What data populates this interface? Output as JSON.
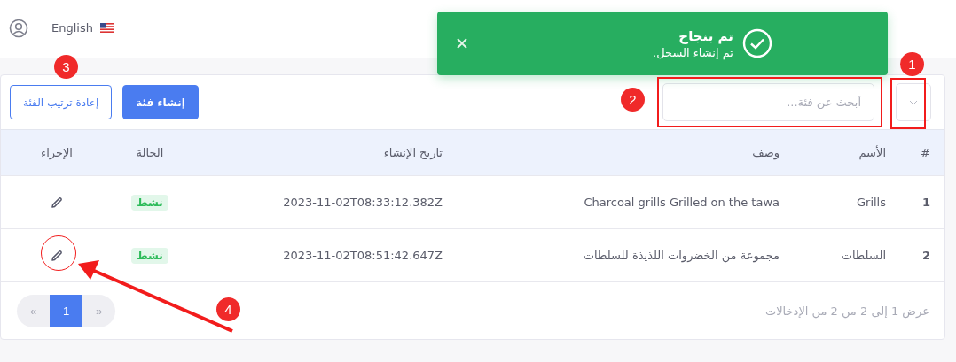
{
  "top_bar": {
    "language": "English"
  },
  "toast": {
    "title": "تم بنجاح",
    "message": "تم إنشاء السجل."
  },
  "toolbar": {
    "search": {
      "placeholder": "أبحث عن فئة..."
    },
    "buttons": [
      {
        "label": "إنشاء فئة",
        "kind": "primary"
      },
      {
        "label": "إعادة ترتيب الفئة",
        "kind": "outline"
      }
    ]
  },
  "table": {
    "columns": [
      "#",
      "الأسم",
      "وصف",
      "تاريخ الإنشاء",
      "الحالة",
      "الإجراء"
    ],
    "rows": [
      {
        "index": "1",
        "name": "Grills",
        "description": "Charcoal grills Grilled on the tawa",
        "created": "2023-11-02T08:33:12.382Z",
        "status": {
          "label": "نشط",
          "kind": "active"
        }
      },
      {
        "index": "2",
        "name": "السلطات",
        "description": "مجموعة من الخضروات اللذيذة للسلطات",
        "created": "2023-11-02T08:51:42.647Z",
        "status": {
          "label": "نشط",
          "kind": "active"
        }
      }
    ]
  },
  "footer": {
    "info": "عرض 1 إلى 2 من 2 من الإدخالات",
    "pagination": {
      "prev": "«",
      "pages": [
        {
          "label": "1",
          "selected": true
        }
      ],
      "next": "»"
    }
  },
  "annotations": [
    {
      "label": "1"
    },
    {
      "label": "2"
    },
    {
      "label": "3"
    },
    {
      "label": "4"
    }
  ]
}
